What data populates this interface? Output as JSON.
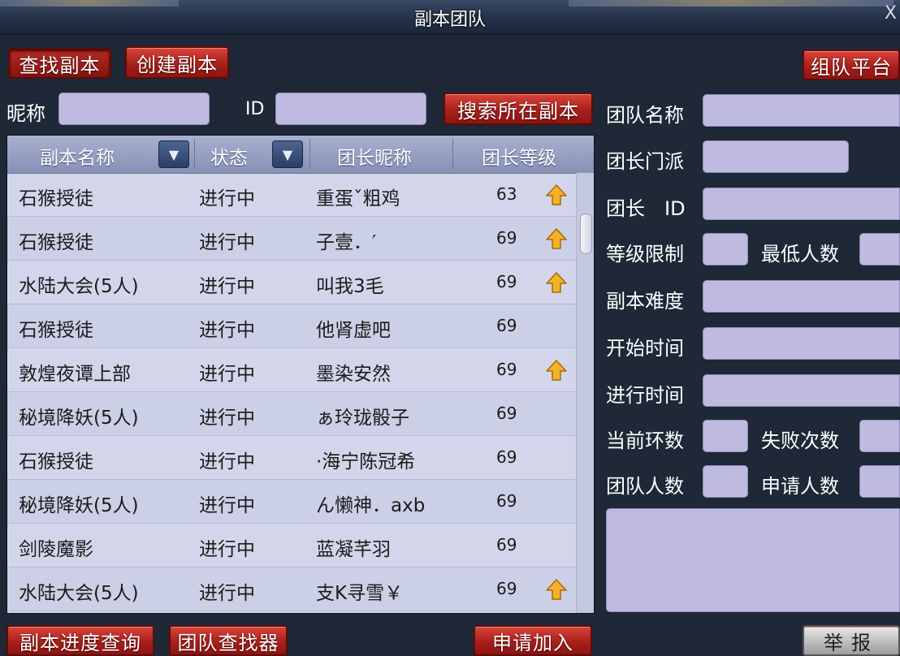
{
  "window": {
    "title": "副本团队",
    "close_label": "X"
  },
  "tabs": {
    "find_dungeon": "查找副本",
    "create_dungeon": "创建副本"
  },
  "team_platform_label": "组队平台",
  "search": {
    "nickname_label": "昵称",
    "nickname_value": "",
    "id_label": "ID",
    "id_value": "",
    "search_button": "搜索所在副本"
  },
  "table": {
    "headers": {
      "name": "副本名称",
      "status": "状态",
      "leader": "团长昵称",
      "level": "团长等级"
    },
    "rows": [
      {
        "name": "石猴授徒",
        "status": "进行中",
        "leader": "重蛋ˇ粗鸡",
        "level": "63",
        "up": true
      },
      {
        "name": "石猴授徒",
        "status": "进行中",
        "leader": "子壹．′",
        "level": "69",
        "up": true
      },
      {
        "name": "水陆大会(5人)",
        "status": "进行中",
        "leader": "叫我3毛",
        "level": "69",
        "up": true
      },
      {
        "name": "石猴授徒",
        "status": "进行中",
        "leader": "他肾虚吧",
        "level": "69",
        "up": false
      },
      {
        "name": "敦煌夜谭上部",
        "status": "进行中",
        "leader": "墨染安然",
        "level": "69",
        "up": true
      },
      {
        "name": "秘境降妖(5人)",
        "status": "进行中",
        "leader": "ぁ玲珑骰子",
        "level": "69",
        "up": false
      },
      {
        "name": "石猴授徒",
        "status": "进行中",
        "leader": "·海宁陈冠希",
        "level": "69",
        "up": false
      },
      {
        "name": "秘境降妖(5人)",
        "status": "进行中",
        "leader": "ん懒神．axb",
        "level": "69",
        "up": false
      },
      {
        "name": "剑陵魔影",
        "status": "进行中",
        "leader": "蓝凝芊羽",
        "level": "69",
        "up": false
      },
      {
        "name": "水陆大会(5人)",
        "status": "进行中",
        "leader": "支K寻雪￥",
        "level": "69",
        "up": true
      }
    ]
  },
  "details": {
    "team_name": "团队名称",
    "leader_sect": "团长门派",
    "leader_id": "团长　ID",
    "level_limit": "等级限制",
    "min_members": "最低人数",
    "difficulty": "副本难度",
    "start_time": "开始时间",
    "elapsed_time": "进行时间",
    "current_round": "当前环数",
    "fail_count": "失败次数",
    "team_size": "团队人数",
    "applicant_count": "申请人数"
  },
  "footer": {
    "progress_query": "副本进度查询",
    "team_finder": "团队查找器",
    "apply_join": "申请加入",
    "report": "举报"
  },
  "colors": {
    "button_red": "#b52a23",
    "field_lavender": "#bfbbe0",
    "panel_bg": "#1e2836",
    "up_arrow": "#f3b22a"
  }
}
